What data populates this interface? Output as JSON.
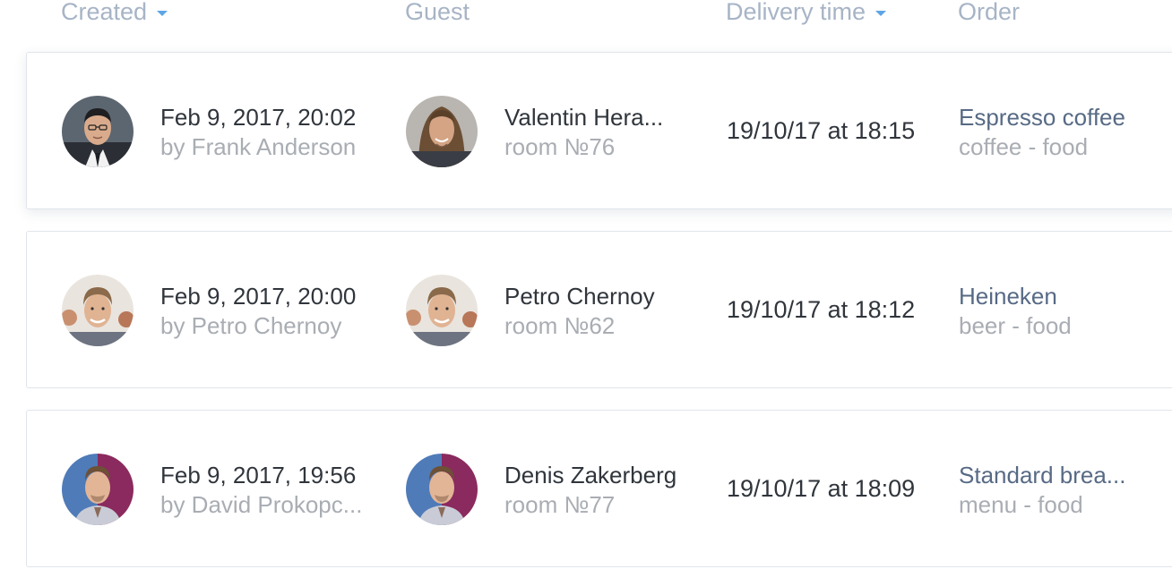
{
  "header": {
    "created": "Created",
    "guest": "Guest",
    "delivery": "Delivery time",
    "order": "Order"
  },
  "rows": [
    {
      "created_date": "Feb 9, 2017, 20:02",
      "created_by": "by Frank Anderson",
      "guest_name": "Valentin Hera...",
      "guest_room": "room №76",
      "delivery_time": "19/10/17 at 18:15",
      "order_item": "Espresso coffee",
      "order_category": "coffee - food"
    },
    {
      "created_date": "Feb 9, 2017, 20:00",
      "created_by": "by Petro Chernoy",
      "guest_name": "Petro Chernoy",
      "guest_room": "room №62",
      "delivery_time": "19/10/17 at 18:12",
      "order_item": "Heineken",
      "order_category": "beer - food"
    },
    {
      "created_date": "Feb 9, 2017, 19:56",
      "created_by": "by David Prokopc...",
      "guest_name": "Denis Zakerberg",
      "guest_room": "room №77",
      "delivery_time": "19/10/17 at 18:09",
      "order_item": "Standard brea...",
      "order_category": "menu - food"
    }
  ],
  "colors": {
    "header_text": "#a7b4c6",
    "sort_caret": "#5fa5e6",
    "primary_text": "#30353c",
    "secondary_text": "#a9adb3",
    "order_link": "#576a85",
    "row_border": "#e1e5ea"
  }
}
